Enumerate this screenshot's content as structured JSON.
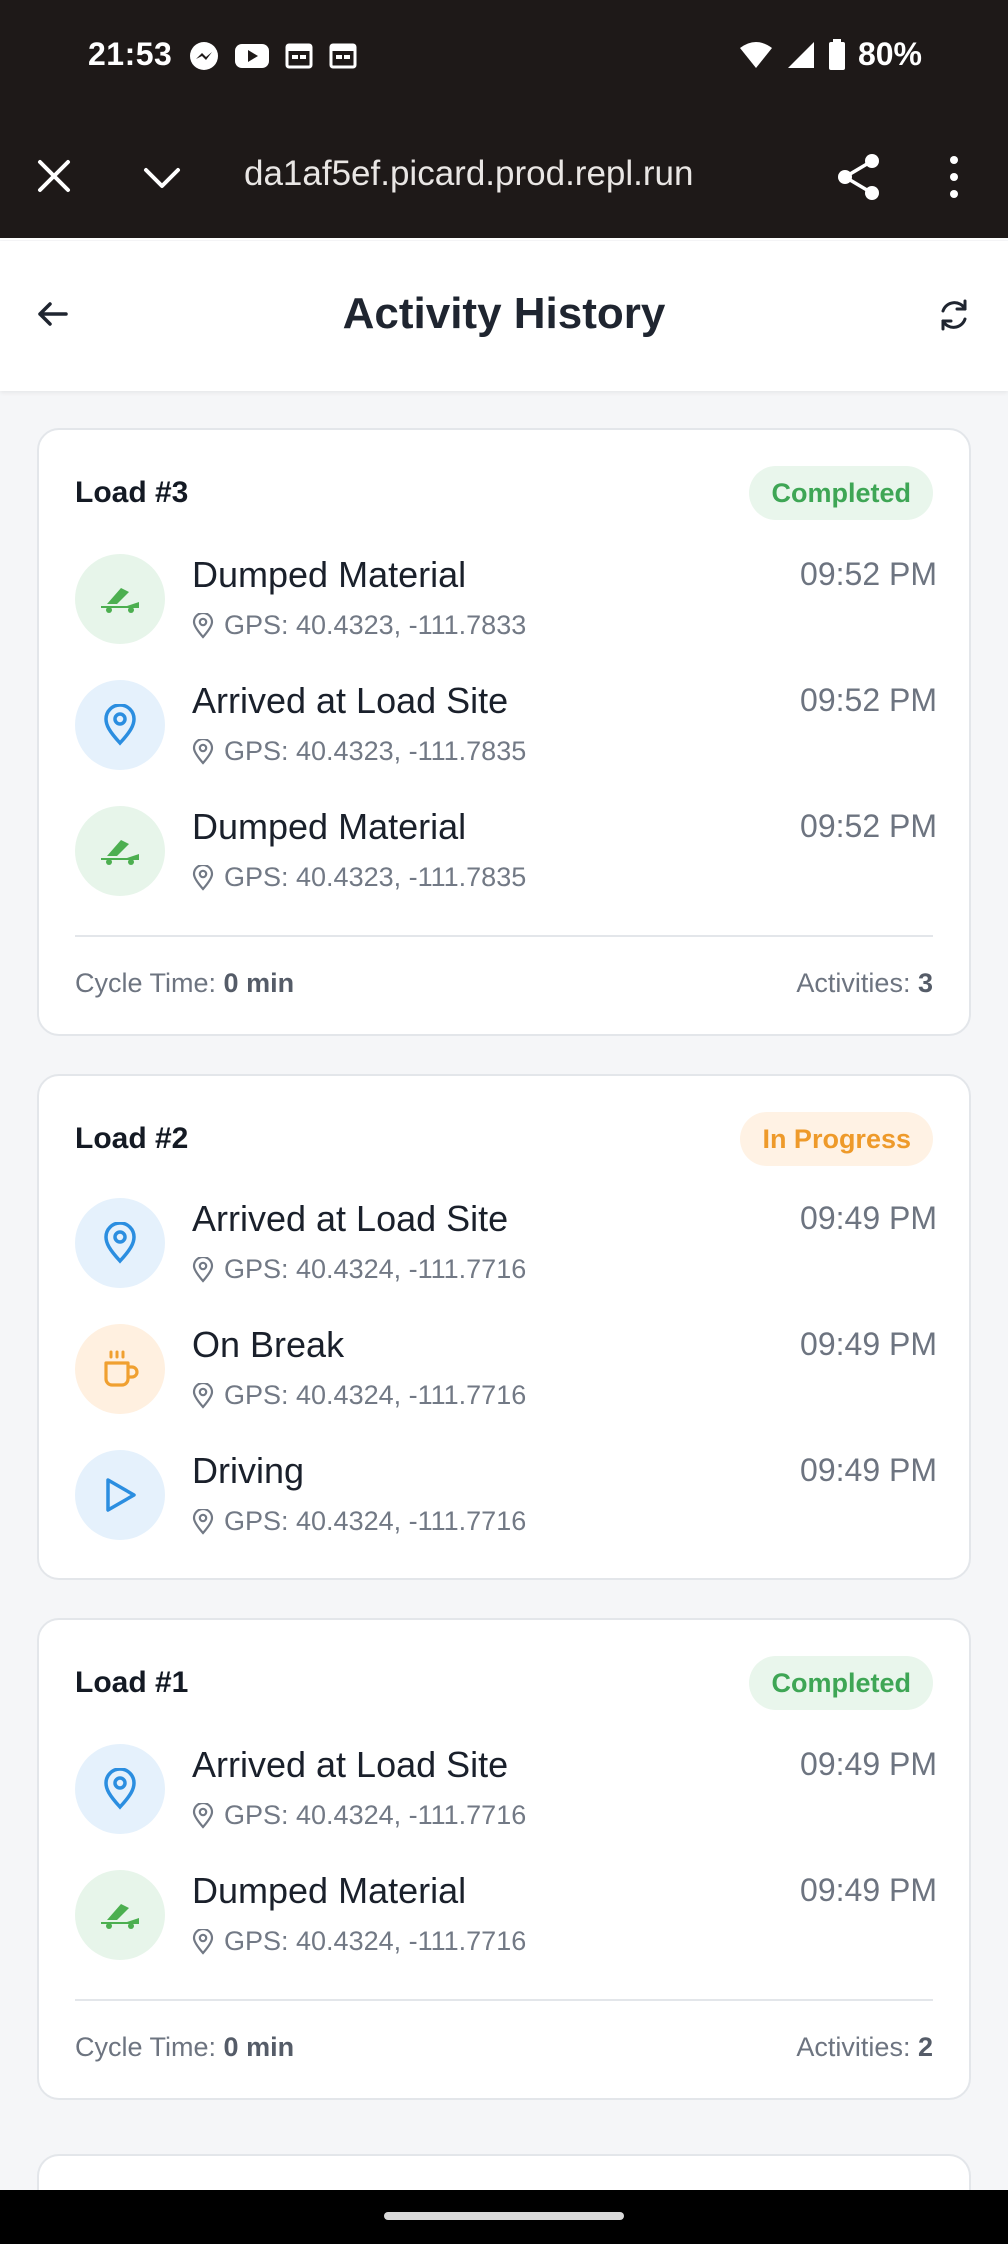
{
  "status_bar": {
    "time": "21:53",
    "battery": "80%",
    "app_icons": [
      "messenger-icon",
      "youtube-icon",
      "calendar-icon",
      "calendar-icon"
    ],
    "system_icons": [
      "wifi-icon",
      "signal-icon",
      "battery-icon"
    ]
  },
  "browser": {
    "url": "da1af5ef.picard.prod.repl.run",
    "icons": [
      "close-icon",
      "chevron-down-icon",
      "share-icon",
      "more-vert-icon"
    ]
  },
  "header": {
    "title": "Activity History",
    "back_icon": "arrow-left-icon",
    "refresh_icon": "refresh-icon"
  },
  "loads": [
    {
      "title": "Load #3",
      "status": "Completed",
      "activities": [
        {
          "name": "Dumped Material",
          "time": "09:52 PM",
          "gps": "GPS: 40.4323, -111.7833",
          "icon": "dump-truck-icon",
          "tone": "green"
        },
        {
          "name": "Arrived at Load Site",
          "time": "09:52 PM",
          "gps": "GPS: 40.4323, -111.7835",
          "icon": "map-pin-icon",
          "tone": "blue"
        },
        {
          "name": "Dumped Material",
          "time": "09:52 PM",
          "gps": "GPS: 40.4323, -111.7835",
          "icon": "dump-truck-icon",
          "tone": "green"
        }
      ],
      "footer": {
        "cycle_label": "Cycle Time:",
        "cycle_value": "0 min",
        "activities_label": "Activities:",
        "activities_value": "3"
      }
    },
    {
      "title": "Load #2",
      "status": "In Progress",
      "activities": [
        {
          "name": "Arrived at Load Site",
          "time": "09:49 PM",
          "gps": "GPS: 40.4324, -111.7716",
          "icon": "map-pin-icon",
          "tone": "blue"
        },
        {
          "name": "On Break",
          "time": "09:49 PM",
          "gps": "GPS: 40.4324, -111.7716",
          "icon": "coffee-icon",
          "tone": "orange"
        },
        {
          "name": "Driving",
          "time": "09:49 PM",
          "gps": "GPS: 40.4324, -111.7716",
          "icon": "play-icon",
          "tone": "blue"
        }
      ]
    },
    {
      "title": "Load #1",
      "status": "Completed",
      "activities": [
        {
          "name": "Arrived at Load Site",
          "time": "09:49 PM",
          "gps": "GPS: 40.4324, -111.7716",
          "icon": "map-pin-icon",
          "tone": "blue"
        },
        {
          "name": "Dumped Material",
          "time": "09:49 PM",
          "gps": "GPS: 40.4324, -111.7716",
          "icon": "dump-truck-icon",
          "tone": "green"
        }
      ],
      "footer": {
        "cycle_label": "Cycle Time:",
        "cycle_value": "0 min",
        "activities_label": "Activities:",
        "activities_value": "2"
      }
    }
  ],
  "colors": {
    "completed_text": "#3ea655",
    "completed_bg": "#e9f6ec",
    "in_progress_text": "#ee9a2a",
    "in_progress_bg": "#fff2e4",
    "blue_icon": "#2b8ee0",
    "green_icon": "#4caf50",
    "orange_icon": "#f0a030"
  }
}
